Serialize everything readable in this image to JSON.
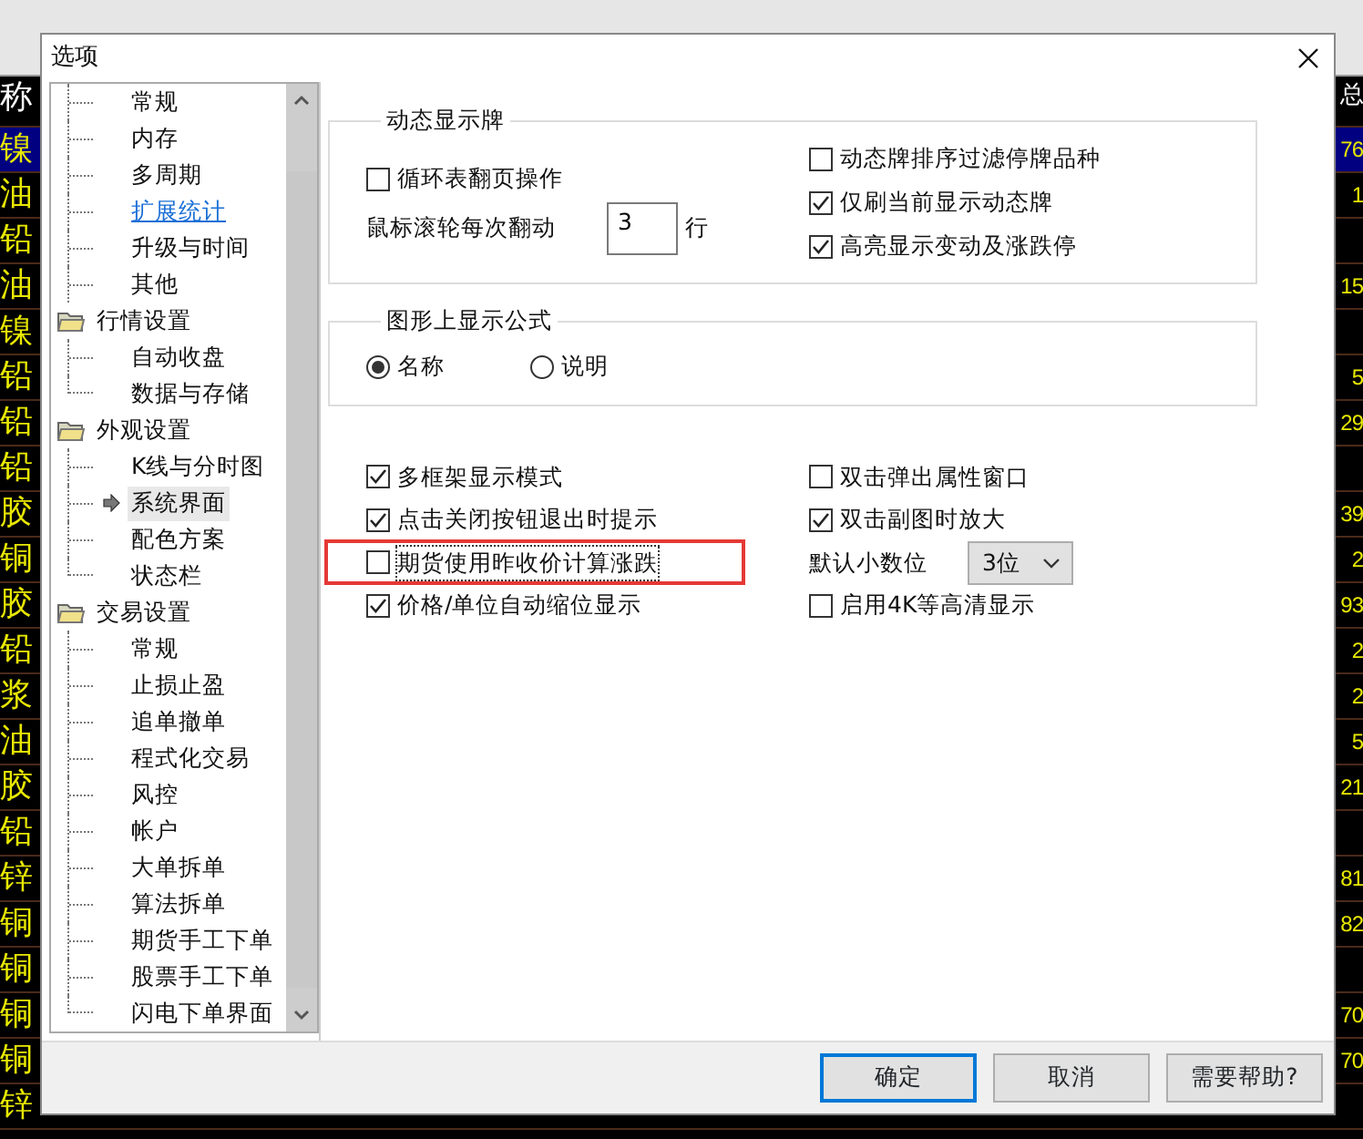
{
  "background_table": {
    "header": [
      "称",
      "总"
    ],
    "rows": [
      {
        "name": "镍",
        "value": "76",
        "selected": true
      },
      {
        "name": "油",
        "value": "1",
        "selected": false
      },
      {
        "name": "铅",
        "value": "",
        "selected": false
      },
      {
        "name": "油",
        "value": "15",
        "selected": false
      },
      {
        "name": "镍",
        "value": "",
        "selected": false
      },
      {
        "name": "铅",
        "value": "5",
        "selected": false
      },
      {
        "name": "铅",
        "value": "29",
        "selected": false
      },
      {
        "name": "铅",
        "value": "",
        "selected": false
      },
      {
        "name": "胶",
        "value": "39",
        "selected": false
      },
      {
        "name": "铜",
        "value": "2",
        "selected": false
      },
      {
        "name": "胶",
        "value": "93",
        "selected": false
      },
      {
        "name": "铅",
        "value": "2",
        "selected": false
      },
      {
        "name": "浆",
        "value": "2",
        "selected": false
      },
      {
        "name": "油",
        "value": "5",
        "selected": false
      },
      {
        "name": "胶",
        "value": "21",
        "selected": false
      },
      {
        "name": "铅",
        "value": "",
        "selected": false
      },
      {
        "name": "锌",
        "value": "81",
        "selected": false
      },
      {
        "name": "铜",
        "value": "82",
        "selected": false
      },
      {
        "name": "铜",
        "value": "",
        "selected": false
      },
      {
        "name": "铜",
        "value": "70",
        "selected": false
      },
      {
        "name": "铜",
        "value": "70",
        "selected": false
      },
      {
        "name": "锌",
        "value": "",
        "selected": false
      }
    ]
  },
  "dialog": {
    "title": "选项",
    "tree": [
      {
        "kind": "item",
        "label": "常规",
        "selected": false,
        "hovered": false
      },
      {
        "kind": "item",
        "label": "内存",
        "selected": false,
        "hovered": false
      },
      {
        "kind": "item",
        "label": "多周期",
        "selected": false,
        "hovered": false
      },
      {
        "kind": "item",
        "label": "扩展统计",
        "selected": false,
        "hovered": true
      },
      {
        "kind": "item",
        "label": "升级与时间",
        "selected": false,
        "hovered": false
      },
      {
        "kind": "item",
        "label": "其他",
        "selected": false,
        "hovered": false
      },
      {
        "kind": "folder",
        "label": "行情设置",
        "children": [
          {
            "label": "自动收盘",
            "selected": false,
            "hovered": false
          },
          {
            "label": "数据与存储",
            "selected": false,
            "hovered": false
          }
        ]
      },
      {
        "kind": "folder",
        "label": "外观设置",
        "children": [
          {
            "label": "K线与分时图",
            "selected": false,
            "hovered": false
          },
          {
            "label": "系统界面",
            "selected": true,
            "hovered": false
          },
          {
            "label": "配色方案",
            "selected": false,
            "hovered": false
          },
          {
            "label": "状态栏",
            "selected": false,
            "hovered": false
          }
        ]
      },
      {
        "kind": "folder",
        "label": "交易设置",
        "children": [
          {
            "label": "常规",
            "selected": false,
            "hovered": false
          },
          {
            "label": "止损止盈",
            "selected": false,
            "hovered": false
          },
          {
            "label": "追单撤单",
            "selected": false,
            "hovered": false
          },
          {
            "label": "程式化交易",
            "selected": false,
            "hovered": false
          },
          {
            "label": "风控",
            "selected": false,
            "hovered": false
          },
          {
            "label": "帐户",
            "selected": false,
            "hovered": false
          },
          {
            "label": "大单拆单",
            "selected": false,
            "hovered": false
          },
          {
            "label": "算法拆单",
            "selected": false,
            "hovered": false
          },
          {
            "label": "期货手工下单",
            "selected": false,
            "hovered": false
          },
          {
            "label": "股票手工下单",
            "selected": false,
            "hovered": false
          },
          {
            "label": "闪电下单界面",
            "selected": false,
            "hovered": false
          }
        ]
      }
    ],
    "dynamic_board": {
      "title": "动态显示牌",
      "left": [
        {
          "kind": "checkbox",
          "label": "循环表翻页操作",
          "checked": false,
          "focused": false
        },
        {
          "kind": "spin",
          "label": "鼠标滚轮每次翻动",
          "value": "3",
          "unit": "行"
        }
      ],
      "right": [
        {
          "kind": "checkbox",
          "label": "动态牌排序过滤停牌品种",
          "checked": false,
          "focused": false
        },
        {
          "kind": "checkbox",
          "label": "仅刷当前显示动态牌",
          "checked": true,
          "focused": false
        },
        {
          "kind": "checkbox",
          "label": "高亮显示变动及涨跌停",
          "checked": true,
          "focused": false
        }
      ]
    },
    "formula_display": {
      "title": "图形上显示公式",
      "options": [
        {
          "label": "名称",
          "selected": true
        },
        {
          "label": "说明",
          "selected": false
        }
      ]
    },
    "options": {
      "left": [
        {
          "kind": "checkbox",
          "label": "多框架显示模式",
          "checked": true,
          "focused": false
        },
        {
          "kind": "checkbox",
          "label": "点击关闭按钮退出时提示",
          "checked": true,
          "focused": false
        },
        {
          "kind": "checkbox",
          "label": "期货使用昨收价计算涨跌",
          "checked": false,
          "focused": true
        },
        {
          "kind": "checkbox",
          "label": "价格/单位自动缩位显示",
          "checked": true,
          "focused": false
        }
      ],
      "right": [
        {
          "kind": "checkbox",
          "label": "双击弹出属性窗口",
          "checked": false,
          "focused": false
        },
        {
          "kind": "checkbox",
          "label": "双击副图时放大",
          "checked": true,
          "focused": false
        },
        {
          "kind": "select",
          "label": "默认小数位",
          "value": "3位"
        },
        {
          "kind": "checkbox",
          "label": "启用4K等高清显示",
          "checked": false,
          "focused": false
        }
      ]
    },
    "buttons": [
      {
        "label": "确定",
        "default": true
      },
      {
        "label": "取消",
        "default": false
      },
      {
        "label": "需要帮助?",
        "default": false
      }
    ]
  }
}
